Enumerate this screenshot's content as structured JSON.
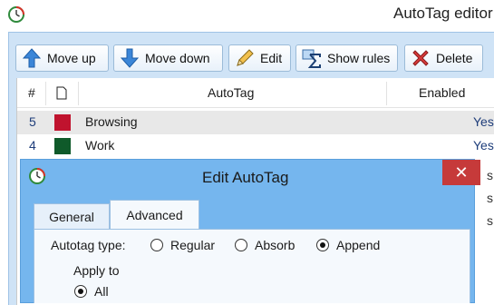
{
  "main": {
    "title": "AutoTag editor",
    "toolbar": {
      "move_up": "Move up",
      "move_down": "Move down",
      "edit": "Edit",
      "show_rules": "Show rules",
      "delete": "Delete"
    },
    "columns": {
      "num": "#",
      "color": "",
      "autotag": "AutoTag",
      "enabled": "Enabled"
    },
    "rows": [
      {
        "num": "5",
        "color": "#c0132e",
        "name": "Browsing",
        "enabled": "Yes",
        "selected": true
      },
      {
        "num": "4",
        "color": "#0f5a2a",
        "name": "Work",
        "enabled": "Yes",
        "selected": false
      }
    ],
    "partial_rows": [
      "s",
      "s",
      "s"
    ]
  },
  "dialog": {
    "title": "Edit AutoTag",
    "close_glyph": "✕",
    "tabs": {
      "general": "General",
      "advanced": "Advanced"
    },
    "autotag_type_label": "Autotag type:",
    "types": {
      "regular": "Regular",
      "absorb": "Absorb",
      "append": "Append"
    },
    "selected_type": "Append",
    "apply_to_label": "Apply to",
    "apply_all": "All"
  },
  "colors": {
    "accent": "#75b6ee",
    "close_red": "#c63a3a",
    "frame": "#cfe3f6"
  },
  "icons": [
    "app-logo-icon",
    "arrow-up-icon",
    "arrow-down-icon",
    "pencil-icon",
    "sigma-rules-icon",
    "delete-x-icon",
    "document-icon"
  ]
}
